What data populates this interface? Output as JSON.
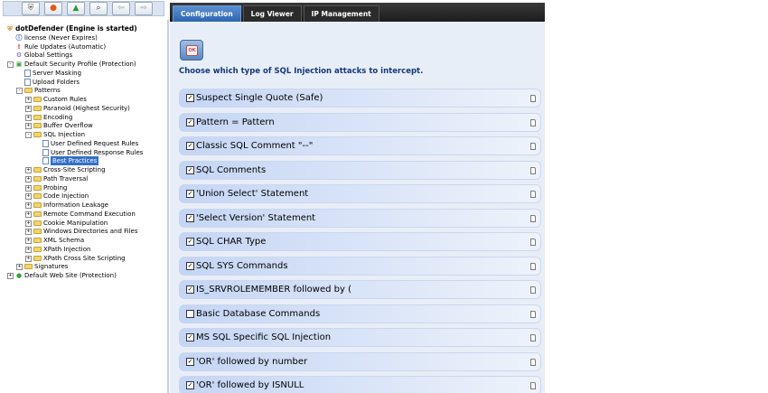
{
  "toolbar": {
    "buttons": [
      {
        "icon": "shield-icon",
        "glyph": "⛨"
      },
      {
        "icon": "stop-icon",
        "glyph": "●"
      },
      {
        "icon": "up-arrow-icon",
        "glyph": "▲"
      },
      {
        "icon": "search-icon",
        "glyph": "⌕"
      },
      {
        "icon": "back-arrow-icon",
        "glyph": "⇦"
      },
      {
        "icon": "forward-arrow-icon",
        "glyph": "⇨"
      }
    ]
  },
  "tree": [
    {
      "label": "dotDefender (Engine is started)",
      "level": 0,
      "icon": "shield",
      "expander": "",
      "kind": "root"
    },
    {
      "label": "license (Never Expires)",
      "level": 1,
      "icon": "info",
      "expander": ""
    },
    {
      "label": "Rule Updates (Automatic)",
      "level": 1,
      "icon": "warning",
      "expander": ""
    },
    {
      "label": "Global Settings",
      "level": 1,
      "icon": "gear",
      "expander": ""
    },
    {
      "label": "Default Security Profile (Protection)",
      "level": 1,
      "icon": "profile",
      "expander": "-"
    },
    {
      "label": "Server Masking",
      "level": 2,
      "icon": "doc",
      "expander": ""
    },
    {
      "label": "Upload Folders",
      "level": 2,
      "icon": "doc",
      "expander": ""
    },
    {
      "label": "Patterns",
      "level": 2,
      "icon": "folder",
      "expander": "-"
    },
    {
      "label": "Custom Rules",
      "level": 3,
      "icon": "folder",
      "expander": "+"
    },
    {
      "label": "Paranoid (Highest Security)",
      "level": 3,
      "icon": "folder",
      "expander": "+"
    },
    {
      "label": "Encoding",
      "level": 3,
      "icon": "folder",
      "expander": "+"
    },
    {
      "label": "Buffer Overflow",
      "level": 3,
      "icon": "folder",
      "expander": "+"
    },
    {
      "label": "SQL Injection",
      "level": 3,
      "icon": "folder",
      "expander": "-"
    },
    {
      "label": "User Defined Request Rules",
      "level": 4,
      "icon": "doc",
      "expander": ""
    },
    {
      "label": "User Defined Response Rules",
      "level": 4,
      "icon": "doc",
      "expander": ""
    },
    {
      "label": "Best Practices",
      "level": 4,
      "icon": "doc",
      "expander": "",
      "selected": true
    },
    {
      "label": "Cross-Site Scripting",
      "level": 3,
      "icon": "folder",
      "expander": "+"
    },
    {
      "label": "Path Traversal",
      "level": 3,
      "icon": "folder",
      "expander": "+"
    },
    {
      "label": "Probing",
      "level": 3,
      "icon": "folder",
      "expander": "+"
    },
    {
      "label": "Code Injection",
      "level": 3,
      "icon": "folder",
      "expander": "+"
    },
    {
      "label": "Information Leakage",
      "level": 3,
      "icon": "folder",
      "expander": "+"
    },
    {
      "label": "Remote Command Execution",
      "level": 3,
      "icon": "folder",
      "expander": "+"
    },
    {
      "label": "Cookie Manipulation",
      "level": 3,
      "icon": "folder",
      "expander": "+"
    },
    {
      "label": "Windows Directories and Files",
      "level": 3,
      "icon": "folder",
      "expander": "+"
    },
    {
      "label": "XML Schema",
      "level": 3,
      "icon": "folder",
      "expander": "+"
    },
    {
      "label": "XPath Injection",
      "level": 3,
      "icon": "folder",
      "expander": "+"
    },
    {
      "label": "XPath Cross Site Scripting",
      "level": 3,
      "icon": "folder",
      "expander": "+"
    },
    {
      "label": "Signatures",
      "level": 2,
      "icon": "folder",
      "expander": "+"
    },
    {
      "label": "Default Web Site (Protection)",
      "level": 1,
      "icon": "site",
      "expander": "+"
    }
  ],
  "tabs": [
    {
      "label": "Configuration",
      "active": true
    },
    {
      "label": "Log Viewer",
      "active": false
    },
    {
      "label": "IP Management",
      "active": false
    }
  ],
  "main": {
    "icon_label": "OK",
    "heading": "Choose which type of SQL Injection attacks to intercept.",
    "rules": [
      {
        "label": "Suspect Single Quote (Safe)",
        "checked": true
      },
      {
        "label": "Pattern = Pattern",
        "checked": true
      },
      {
        "label": "Classic SQL Comment \"--\"",
        "checked": true
      },
      {
        "label": "SQL Comments",
        "checked": true
      },
      {
        "label": "'Union Select' Statement",
        "checked": true
      },
      {
        "label": "'Select Version' Statement",
        "checked": true
      },
      {
        "label": "SQL CHAR Type",
        "checked": true
      },
      {
        "label": "SQL SYS Commands",
        "checked": true
      },
      {
        "label": "IS_SRVROLEMEMBER followed by (",
        "checked": true
      },
      {
        "label": "Basic Database Commands",
        "checked": false
      },
      {
        "label": "MS SQL Specific SQL Injection",
        "checked": true
      },
      {
        "label": "'OR' followed by number",
        "checked": true
      },
      {
        "label": "'OR' followed by ISNULL",
        "checked": true
      }
    ]
  }
}
